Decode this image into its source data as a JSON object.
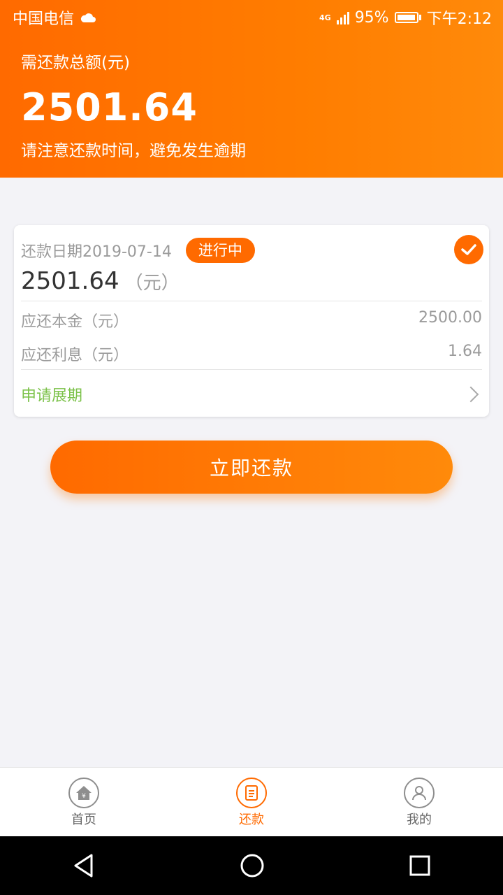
{
  "status_bar": {
    "carrier": "中国电信",
    "network": "4G",
    "battery": "95%",
    "time": "下午2:12"
  },
  "header": {
    "label": "需还款总额(元)",
    "total": "2501.64",
    "notice": "请注意还款时间，避免发生逾期"
  },
  "card": {
    "due_date": "还款日期2019-07-14",
    "status": "进行中",
    "amount": "2501.64",
    "amount_unit": "（元）",
    "principal_label": "应还本金（元）",
    "principal_value": "2500.00",
    "interest_label": "应还利息（元）",
    "interest_value": "1.64",
    "extension_label": "申请展期"
  },
  "pay_button": "立即还款",
  "tabs": [
    {
      "label": "首页",
      "icon": "home-icon"
    },
    {
      "label": "还款",
      "icon": "bill-icon"
    },
    {
      "label": "我的",
      "icon": "user-icon"
    }
  ],
  "colors": {
    "accent": "#ff6a00",
    "green": "#7cc24a"
  }
}
